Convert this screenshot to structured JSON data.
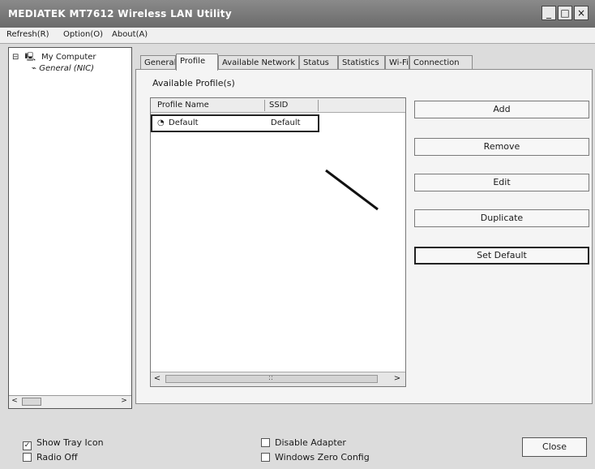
{
  "window": {
    "title": "MEDIATEK MT7612 Wireless LAN Utility",
    "controls": {
      "minimize": "_",
      "maximize": "□",
      "close": "×"
    }
  },
  "menu": [
    "Refresh(R)",
    "Option(O)",
    "About(A)"
  ],
  "tree": {
    "root": "My Computer",
    "child": "General (NIC)",
    "scroll": {
      "left": "<",
      "right": ">"
    }
  },
  "tabs": [
    "General",
    "Profile",
    "Available Network",
    "Status",
    "Statistics",
    "Wi-Fi",
    "Connection"
  ],
  "active_tab": "Profile",
  "profile_panel": {
    "section_label": "Available Profile(s)",
    "columns": [
      "Profile Name",
      "SSID"
    ],
    "rows": [
      {
        "name": "Default",
        "ssid": "Default",
        "icon": "profile-icon"
      }
    ],
    "scroll": {
      "left": "<",
      "right": ">",
      "grip": "::"
    }
  },
  "buttons": [
    "Add",
    "Remove",
    "Edit",
    "Duplicate",
    "Set Default"
  ],
  "bottom": {
    "checkboxes_left": [
      {
        "label": "Show Tray Icon",
        "checked": true
      },
      {
        "label": "Radio Off",
        "checked": false
      }
    ],
    "checkboxes_mid": [
      {
        "label": "Disable Adapter",
        "checked": false
      },
      {
        "label": "Windows Zero Config",
        "checked": false
      }
    ],
    "close_label": "Close"
  }
}
